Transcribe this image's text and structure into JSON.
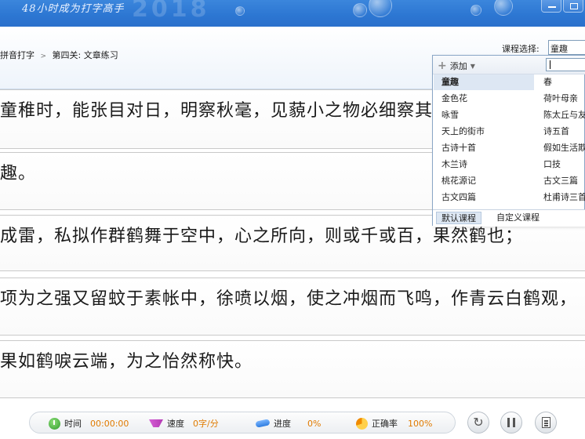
{
  "banner": {
    "slogan": "48小时成为打字高手",
    "year_watermark": "2018"
  },
  "breadcrumb": {
    "part1": "拼音打字",
    "separator": ">",
    "part2": "第四关: 文章练习"
  },
  "course": {
    "label": "课程选择:",
    "selected": "童趣"
  },
  "dropdown": {
    "add_label": "添加",
    "search_value": "",
    "col1": [
      "童趣",
      "金色花",
      "咏雪",
      "天上的街市",
      "古诗十首",
      "木兰诗",
      "桃花源记",
      "古文四篇"
    ],
    "col2": [
      "春",
      "荷叶母亲",
      "陈太丘与友",
      "诗五首",
      "假如生活欺",
      "口技",
      "古文三篇",
      "杜甫诗三首"
    ],
    "tabs": {
      "default": "默认课程",
      "custom": "自定义课程"
    }
  },
  "lines": [
    "童稚时，能张目对日，明察秋毫，见藐小之物必细察其纹理，故时有物外之趣。",
    "趣。",
    "成雷，私拟作群鹤舞于空中，心之所向，则或千或百，果然鹤也；",
    "  项为之强又留蚊于素帐中，徐喷以烟，使之冲烟而飞鸣，作青云白鹤观，",
    "果如鹤唳云端，为之怡然称快。"
  ],
  "status": {
    "time_label": "时间",
    "time_value": "00:00:00",
    "speed_label": "速度",
    "speed_value": "0字/分",
    "progress_label": "进度",
    "progress_value": "0%",
    "accuracy_label": "正确率",
    "accuracy_value": "100%"
  },
  "icons": {
    "time": "clock-icon",
    "speed": "speed-icon",
    "progress": "progress-icon",
    "accuracy": "accuracy-icon",
    "restart": "restart-icon",
    "pause": "pause-icon",
    "doc": "doc-icon"
  },
  "colors": {
    "banner": "#2c76d2",
    "accent_value": "#e07a00",
    "selection": "#dde7f3"
  }
}
